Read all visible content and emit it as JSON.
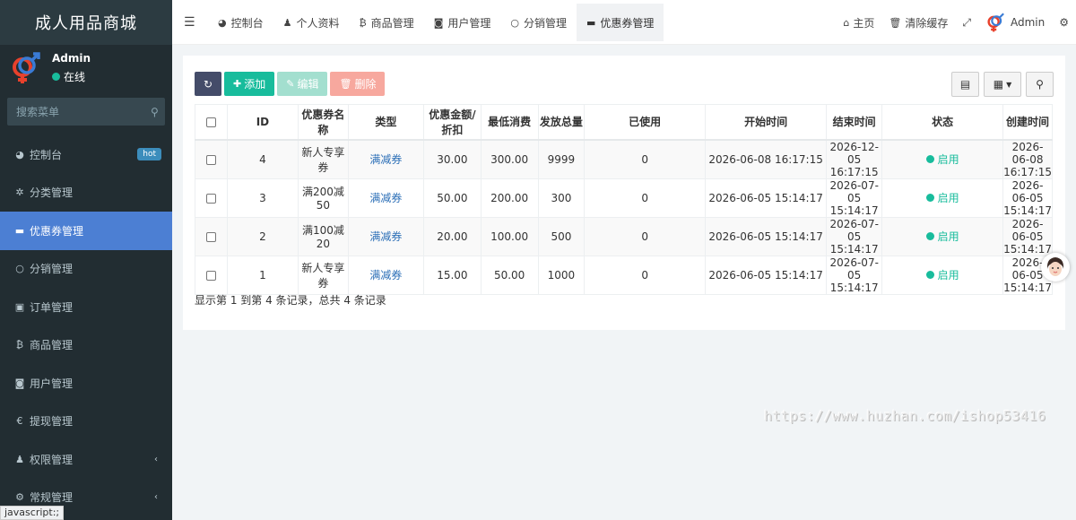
{
  "sidebar": {
    "brand": "成人用品商城",
    "user_name": "Admin",
    "user_status": "在线",
    "search_placeholder": "搜索菜单",
    "items": [
      {
        "label": "控制台",
        "icon": "dashboard-icon",
        "glyph": "◕",
        "badge": "hot"
      },
      {
        "label": "分类管理",
        "icon": "sitemap-icon",
        "glyph": "✲"
      },
      {
        "label": "优惠券管理",
        "icon": "credit-card-icon",
        "glyph": "▬",
        "active": true
      },
      {
        "label": "分销管理",
        "icon": "circle-icon",
        "glyph": "○"
      },
      {
        "label": "订单管理",
        "icon": "file-icon",
        "glyph": "▣"
      },
      {
        "label": "商品管理",
        "icon": "bitcoin-icon",
        "glyph": "₿"
      },
      {
        "label": "用户管理",
        "icon": "address-book-icon",
        "glyph": "◙"
      },
      {
        "label": "提现管理",
        "icon": "euro-icon",
        "glyph": "€"
      },
      {
        "label": "权限管理",
        "icon": "group-icon",
        "glyph": "♟",
        "chevron": "‹"
      },
      {
        "label": "常规管理",
        "icon": "cogs-icon",
        "glyph": "⚙",
        "chevron": "‹"
      }
    ],
    "statusbar": "javascript:;"
  },
  "topnav": {
    "tabs": [
      {
        "label": "控制台",
        "icon": "dashboard-icon",
        "glyph": "◕"
      },
      {
        "label": "个人资料",
        "icon": "user-icon",
        "glyph": "♟"
      },
      {
        "label": "商品管理",
        "icon": "bitcoin-icon",
        "glyph": "₿"
      },
      {
        "label": "用户管理",
        "icon": "address-book-icon",
        "glyph": "◙"
      },
      {
        "label": "分销管理",
        "icon": "circle-icon",
        "glyph": "○"
      },
      {
        "label": "优惠券管理",
        "icon": "credit-card-icon",
        "glyph": "▬",
        "active": true
      }
    ],
    "home": "主页",
    "clear_cache": "清除缓存",
    "admin": "Admin"
  },
  "toolbar": {
    "add": "添加",
    "edit": "编辑",
    "delete": "删除"
  },
  "table": {
    "headers": [
      "ID",
      "优惠券名称",
      "类型",
      "优惠金额/折扣",
      "最低消费",
      "发放总量",
      "已使用",
      "开始时间",
      "结束时间",
      "状态",
      "创建时间"
    ],
    "rows": [
      [
        "4",
        "新人专享券",
        "满减券",
        "30.00",
        "300.00",
        "9999",
        "0",
        "2026-06-08 16:17:15",
        "2026-12-05 16:17:15",
        "启用",
        "2026-06-08 16:17:15"
      ],
      [
        "3",
        "满200减50",
        "满减券",
        "50.00",
        "200.00",
        "300",
        "0",
        "2026-06-05 15:14:17",
        "2026-07-05 15:14:17",
        "启用",
        "2026-06-05 15:14:17"
      ],
      [
        "2",
        "满100减20",
        "满减券",
        "20.00",
        "100.00",
        "500",
        "0",
        "2026-06-05 15:14:17",
        "2026-07-05 15:14:17",
        "启用",
        "2026-06-05 15:14:17"
      ],
      [
        "1",
        "新人专享券",
        "满减券",
        "15.00",
        "50.00",
        "1000",
        "0",
        "2026-06-05 15:14:17",
        "2026-07-05 15:14:17",
        "启用",
        "2026-06-05 15:14:17"
      ]
    ]
  },
  "pagination_info": "显示第 1 到第 4 条记录，总共 4 条记录",
  "watermark": "https://www.huzhan.com/ishop53416",
  "colors": {
    "sidebar_bg": "#222d32",
    "active_menu": "#4c7fd3",
    "success": "#18bc9c",
    "danger_light": "#f7a89e"
  }
}
